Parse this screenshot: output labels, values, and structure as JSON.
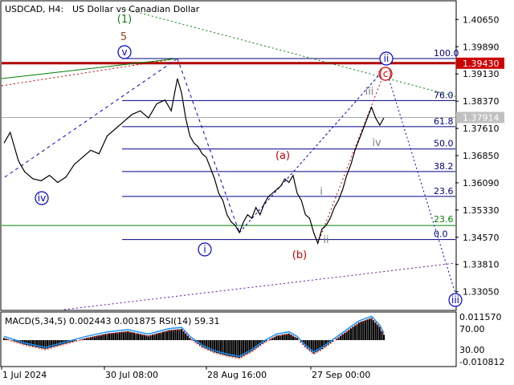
{
  "header": {
    "symbol_tf": "USDCAD, H4:",
    "description": "US Dollar vs Canadian Dollar"
  },
  "indicator": {
    "label": "MACD(5,34,5) 0.002443 0.001875 RSI(14) 59.31",
    "scale_labels": [
      "0.011570",
      "70.00",
      "30.00",
      "-0.010812"
    ],
    "scale_values": [
      0.01157,
      70.0,
      30.0,
      -0.010812
    ]
  },
  "chart_data": {
    "type": "candlestick",
    "title": "USDCAD, H4:  US Dollar vs Canadian Dollar",
    "ylim": [
      1.3255,
      1.4115
    ],
    "y_ticks": [
      1.4065,
      1.3989,
      1.3913,
      1.3837,
      1.3761,
      1.3685,
      1.3609,
      1.3533,
      1.3457,
      1.3381,
      1.3305
    ],
    "y_tick_labels": [
      "1.40650",
      "1.39890",
      "1.39130",
      "1.38370",
      "1.37610",
      "1.36850",
      "1.36090",
      "1.35330",
      "1.34570",
      "1.33810",
      "1.33050"
    ],
    "x_tick_labels": [
      "1 Jul 2024",
      "30 Jul 08:00",
      "28 Aug 16:00",
      "27 Sep 00:00"
    ],
    "current_price": 1.37914,
    "current_price_label": "1.37914",
    "resistance_level": 1.3943,
    "resistance_label": "1.39430",
    "support_line_level": 1.349,
    "fibonacci": {
      "high": 1.39561,
      "low": 1.34508,
      "levels": [
        {
          "label": "100.0",
          "value": 1.39561
        },
        {
          "label": "76.0",
          "value": 1.38388
        },
        {
          "label": "61.8",
          "value": 1.37659
        },
        {
          "label": "50.0",
          "value": 1.37035
        },
        {
          "label": "38.2",
          "value": 1.36406
        },
        {
          "label": "23.6",
          "value": 1.35711
        },
        {
          "label": "0.0",
          "value": 1.34508
        }
      ],
      "extra_label": "23.6"
    },
    "wave_labels": [
      {
        "text": "(1)",
        "style": "green"
      },
      {
        "text": "5",
        "style": "dark-red"
      },
      {
        "text": "v",
        "style": "blue-circle"
      },
      {
        "text": "iv",
        "style": "blue-circle"
      },
      {
        "text": "i",
        "style": "blue-circle"
      },
      {
        "text": "(a)",
        "style": "red"
      },
      {
        "text": "(b)",
        "style": "red"
      },
      {
        "text": "(c)",
        "style": "red-circle"
      },
      {
        "text": "ii",
        "style": "blue-circle"
      },
      {
        "text": "iii",
        "style": "gray"
      },
      {
        "text": "iv",
        "style": "gray"
      },
      {
        "text": "i",
        "style": "gray"
      },
      {
        "text": "ii",
        "style": "gray"
      },
      {
        "text": "iii",
        "style": "blue-circle"
      }
    ],
    "price_path": [
      [
        0,
        1.372
      ],
      [
        3,
        1.375
      ],
      [
        7,
        1.367
      ],
      [
        10,
        1.364
      ],
      [
        14,
        1.362
      ],
      [
        18,
        1.3615
      ],
      [
        22,
        1.363
      ],
      [
        26,
        1.361
      ],
      [
        30,
        1.3625
      ],
      [
        34,
        1.366
      ],
      [
        38,
        1.368
      ],
      [
        42,
        1.37
      ],
      [
        46,
        1.369
      ],
      [
        50,
        1.374
      ],
      [
        54,
        1.376
      ],
      [
        58,
        1.378
      ],
      [
        62,
        1.38
      ],
      [
        66,
        1.381
      ],
      [
        70,
        1.379
      ],
      [
        74,
        1.383
      ],
      [
        78,
        1.384
      ],
      [
        81,
        1.381
      ],
      [
        84,
        1.39
      ],
      [
        86,
        1.386
      ],
      [
        88,
        1.379
      ],
      [
        90,
        1.374
      ],
      [
        92,
        1.372
      ],
      [
        94,
        1.371
      ],
      [
        96,
        1.369
      ],
      [
        98,
        1.368
      ],
      [
        100,
        1.365
      ],
      [
        102,
        1.362
      ],
      [
        104,
        1.358
      ],
      [
        106,
        1.356
      ],
      [
        108,
        1.352
      ],
      [
        110,
        1.35
      ],
      [
        112,
        1.349
      ],
      [
        114,
        1.347
      ],
      [
        116,
        1.35
      ],
      [
        118,
        1.352
      ],
      [
        120,
        1.351
      ],
      [
        122,
        1.354
      ],
      [
        124,
        1.352
      ],
      [
        126,
        1.355
      ],
      [
        128,
        1.357
      ],
      [
        130,
        1.358
      ],
      [
        132,
        1.359
      ],
      [
        134,
        1.36
      ],
      [
        136,
        1.362
      ],
      [
        138,
        1.361
      ],
      [
        140,
        1.363
      ],
      [
        142,
        1.358
      ],
      [
        144,
        1.356
      ],
      [
        146,
        1.352
      ],
      [
        148,
        1.351
      ],
      [
        150,
        1.347
      ],
      [
        152,
        1.344
      ],
      [
        154,
        1.348
      ],
      [
        156,
        1.349
      ],
      [
        158,
        1.351
      ],
      [
        160,
        1.354
      ],
      [
        162,
        1.356
      ],
      [
        164,
        1.359
      ],
      [
        166,
        1.363
      ],
      [
        168,
        1.366
      ],
      [
        170,
        1.37
      ],
      [
        172,
        1.373
      ],
      [
        174,
        1.376
      ],
      [
        176,
        1.379
      ],
      [
        178,
        1.382
      ],
      [
        180,
        1.379
      ],
      [
        182,
        1.377
      ],
      [
        184,
        1.379
      ]
    ],
    "macd_path": [
      [
        0,
        0.001
      ],
      [
        10,
        -0.002
      ],
      [
        20,
        -0.004
      ],
      [
        30,
        -0.0015
      ],
      [
        40,
        0.001
      ],
      [
        50,
        0.003
      ],
      [
        60,
        0.004
      ],
      [
        70,
        0.002
      ],
      [
        80,
        0.0045
      ],
      [
        86,
        0.005
      ],
      [
        90,
        0.001
      ],
      [
        96,
        -0.003
      ],
      [
        102,
        -0.0055
      ],
      [
        108,
        -0.007
      ],
      [
        114,
        -0.008
      ],
      [
        120,
        -0.005
      ],
      [
        126,
        -0.001
      ],
      [
        132,
        0.002
      ],
      [
        138,
        0.003
      ],
      [
        142,
        0.001
      ],
      [
        146,
        -0.003
      ],
      [
        150,
        -0.006
      ],
      [
        154,
        -0.004
      ],
      [
        160,
        0.0
      ],
      [
        166,
        0.004
      ],
      [
        172,
        0.008
      ],
      [
        178,
        0.01
      ],
      [
        182,
        0.006
      ],
      [
        184,
        0.0024
      ]
    ],
    "x_range": [
      0,
      184
    ]
  }
}
